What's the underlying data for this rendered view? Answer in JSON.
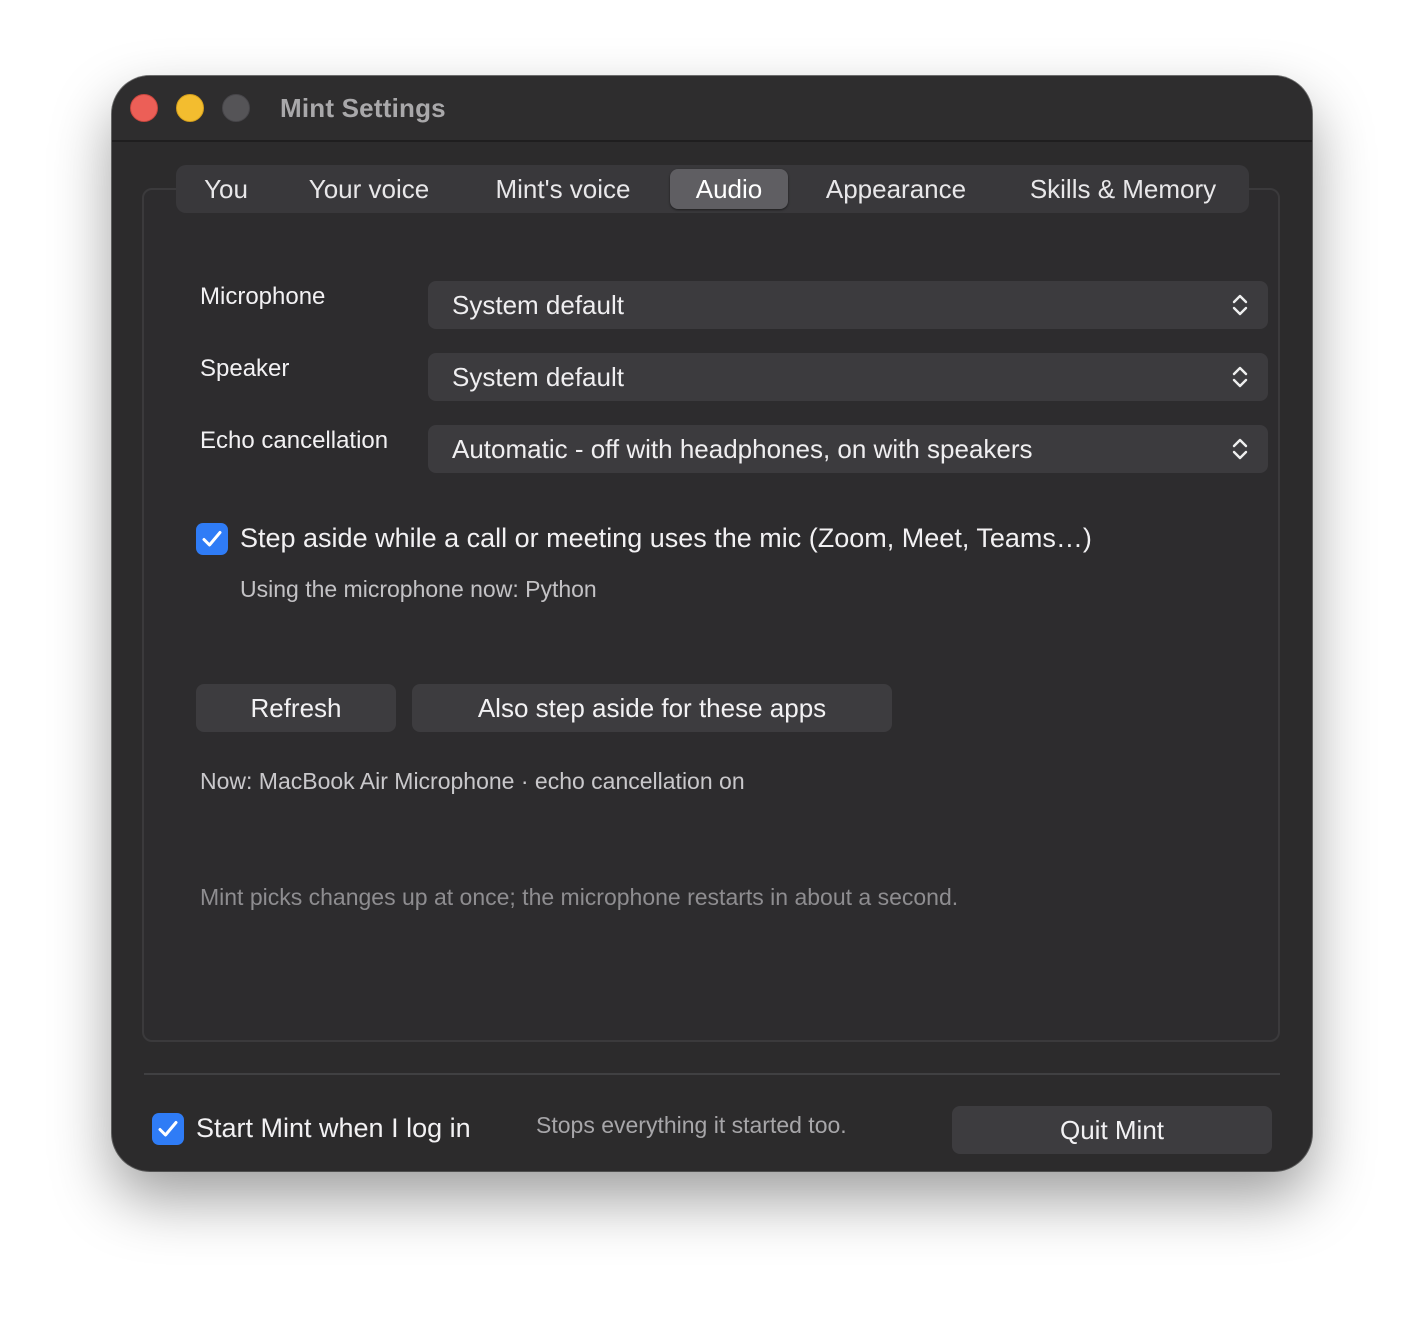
{
  "window": {
    "title": "Mint Settings"
  },
  "tabs": [
    {
      "label": "You",
      "active": false
    },
    {
      "label": "Your voice",
      "active": false
    },
    {
      "label": "Mint's voice",
      "active": false
    },
    {
      "label": "Audio",
      "active": true
    },
    {
      "label": "Appearance",
      "active": false
    },
    {
      "label": "Skills & Memory",
      "active": false
    }
  ],
  "audio": {
    "microphone": {
      "label": "Microphone",
      "value": "System default"
    },
    "speaker": {
      "label": "Speaker",
      "value": "System default"
    },
    "echo": {
      "label": "Echo cancellation",
      "value": "Automatic - off with headphones, on with speakers"
    },
    "step_aside": {
      "checked": true,
      "label": "Step aside while a call or meeting uses the mic (Zoom, Meet, Teams…)",
      "status": "Using the microphone now: Python"
    },
    "refresh_label": "Refresh",
    "also_step_aside_label": "Also step aside for these apps",
    "now_status": "Now: MacBook Air Microphone · echo cancellation on",
    "hint": "Mint picks changes up at once; the microphone restarts in about a second."
  },
  "footer": {
    "start_at_login": {
      "checked": true,
      "label": "Start Mint when I log in"
    },
    "quit_note": "Stops everything it started too.",
    "quit_label": "Quit Mint"
  },
  "colors": {
    "accent": "#2f7cf6",
    "close": "#ec5f57",
    "minimize": "#f3bd2f",
    "zoom_disabled": "#555457",
    "window_bg": "#2c2b2c"
  },
  "icons": {
    "popup_indicator": "chevron-up-down-icon",
    "checkmark": "checkmark-icon"
  }
}
